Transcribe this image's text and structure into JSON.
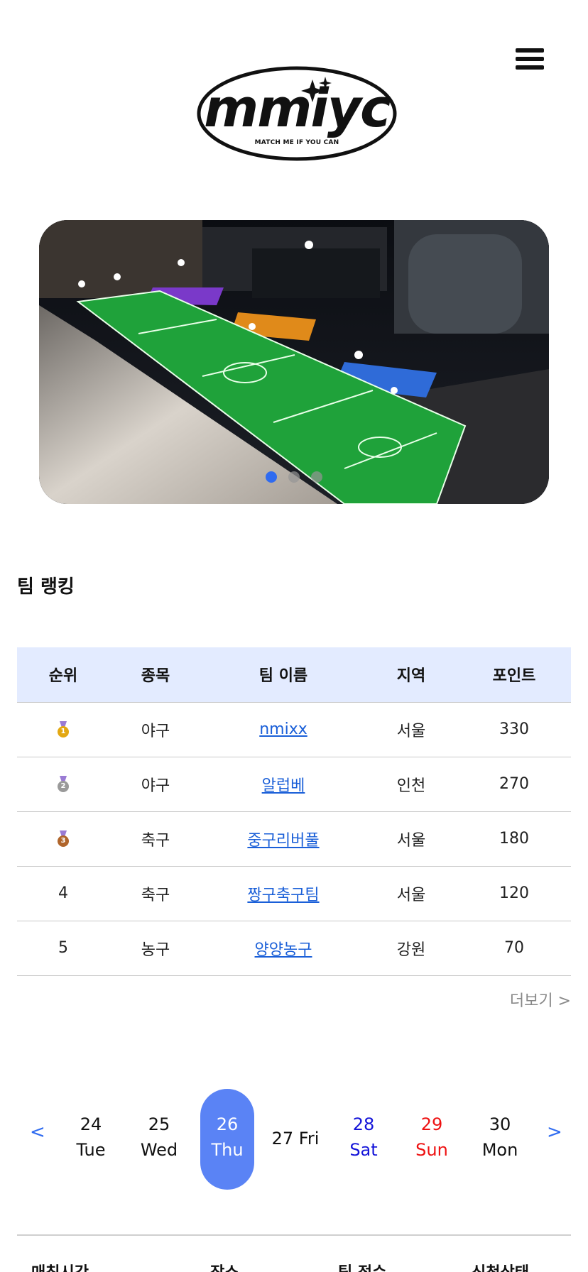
{
  "header": {
    "logo_text": "mmiyc",
    "logo_subtitle": "MATCH ME IF YOU CAN",
    "menu_icon": "hamburger-menu-icon"
  },
  "banner": {
    "slide_count": 3,
    "active_slide": 1
  },
  "ranking": {
    "title": "팀 랭킹",
    "columns": [
      "순위",
      "종목",
      "팀 이름",
      "지역",
      "포인트"
    ],
    "rows": [
      {
        "rank": "1",
        "medal": "gold",
        "sport": "야구",
        "team": "nmixx",
        "region": "서울",
        "points": "330"
      },
      {
        "rank": "2",
        "medal": "silver",
        "sport": "야구",
        "team": "알럽베",
        "region": "인천",
        "points": "270"
      },
      {
        "rank": "3",
        "medal": "bronze",
        "sport": "축구",
        "team": "중구리버풀",
        "region": "서울",
        "points": "180"
      },
      {
        "rank": "4",
        "medal": "",
        "sport": "축구",
        "team": "짱구축구팀",
        "region": "서울",
        "points": "120"
      },
      {
        "rank": "5",
        "medal": "",
        "sport": "농구",
        "team": "양양농구",
        "region": "강원",
        "points": "70"
      }
    ],
    "more_label": "더보기 >",
    "medal_colors": {
      "gold": "#e3a812",
      "silver": "#9a9a9a",
      "bronze": "#b0652b"
    }
  },
  "dates": {
    "prev_label": "<",
    "next_label": ">",
    "days": [
      {
        "num": "24",
        "weekday": "Tue",
        "type": "normal"
      },
      {
        "num": "25",
        "weekday": "Wed",
        "type": "normal"
      },
      {
        "num": "26",
        "weekday": "Thu",
        "type": "selected"
      },
      {
        "num": "27",
        "weekday": "Fri",
        "type": "single",
        "label": "27 Fri"
      },
      {
        "num": "28",
        "weekday": "Sat",
        "type": "sat"
      },
      {
        "num": "29",
        "weekday": "Sun",
        "type": "sun"
      },
      {
        "num": "30",
        "weekday": "Mon",
        "type": "normal"
      }
    ]
  },
  "matches": {
    "columns": [
      "매칭시간",
      "장소",
      "팀 점수",
      "신청상태"
    ]
  },
  "colors": {
    "accent": "#5a83f5",
    "link": "#1a5fd8",
    "table_header_bg": "#e3ebff",
    "saturday": "#1414d9",
    "sunday": "#ee1111"
  }
}
